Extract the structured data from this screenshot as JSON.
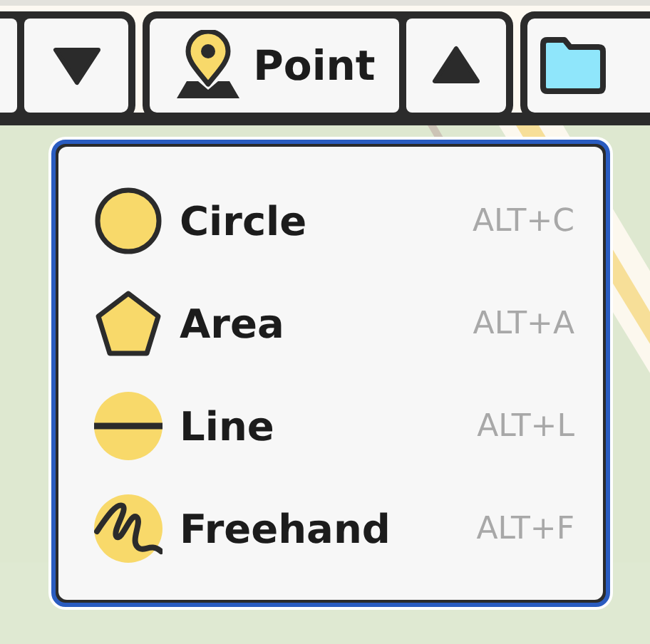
{
  "toolbar": {
    "mode_button": {
      "label": "Point"
    }
  },
  "draw_menu": {
    "items": [
      {
        "kind": "circle",
        "label": "Circle",
        "shortcut": "ALT+C"
      },
      {
        "kind": "area",
        "label": "Area",
        "shortcut": "ALT+A"
      },
      {
        "kind": "line",
        "label": "Line",
        "shortcut": "ALT+L"
      },
      {
        "kind": "freehand",
        "label": "Freehand",
        "shortcut": "ALT+F"
      }
    ]
  }
}
